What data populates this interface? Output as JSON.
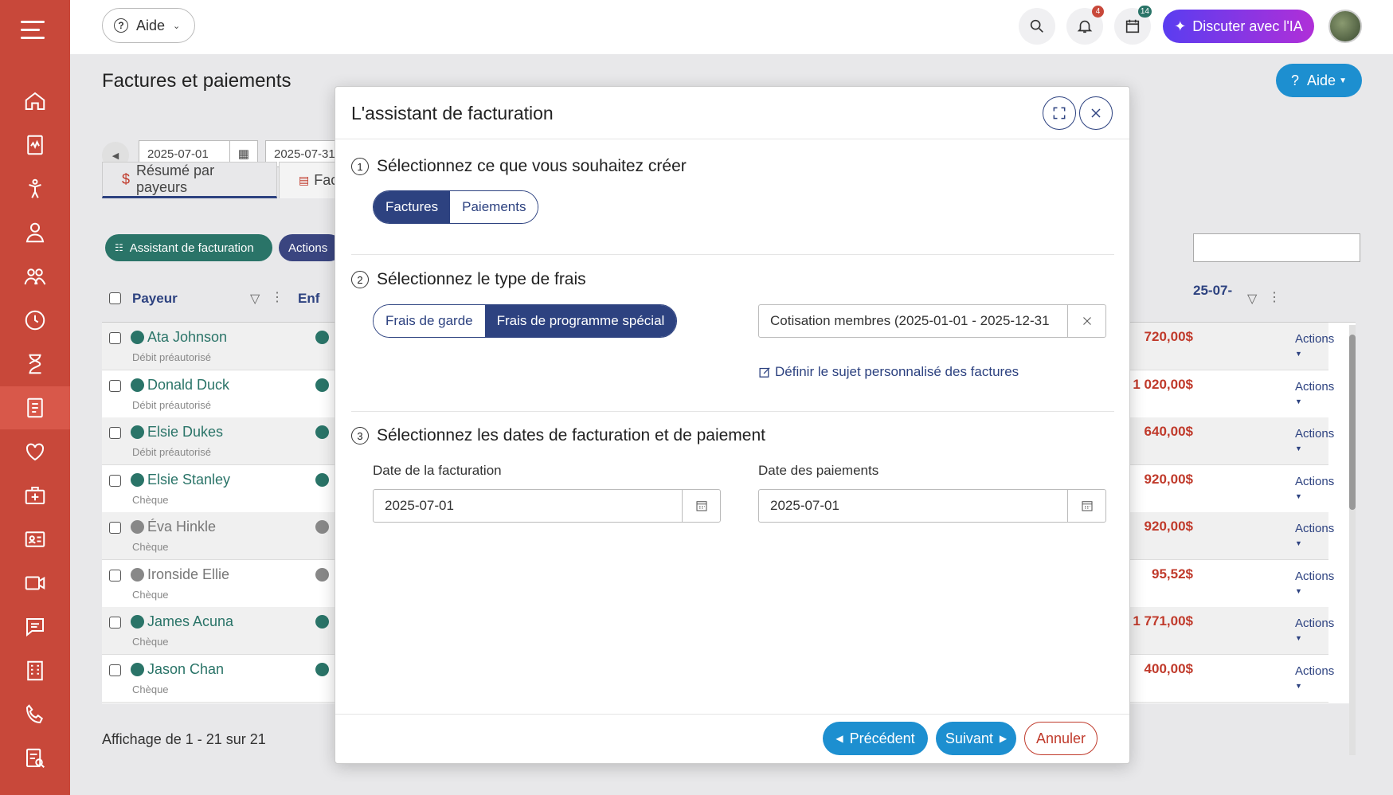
{
  "topbar": {
    "help_label": "Aide",
    "ai_label": "Discuter avec l'IA",
    "notif_count": "4",
    "calendar_count": "14"
  },
  "page": {
    "title": "Factures et paiements",
    "help_label": "Aide",
    "date_from": "2025-07-01",
    "date_to": "2025-07-31",
    "tabs": [
      "Résumé par payeurs",
      "Fac"
    ],
    "billing_assistant_label": "Assistant de facturation",
    "actions_label": "Actions",
    "col_payer": "Payeur",
    "col_child": "Enf",
    "col_date_fragment": "25-07-",
    "footer": "Affichage de 1 - 21 sur 21"
  },
  "rows": [
    {
      "name": "Ata Johnson",
      "method": "Débit préautorisé",
      "amount": "720,00$",
      "action": "Actions",
      "status": "active"
    },
    {
      "name": "Donald Duck",
      "method": "Débit préautorisé",
      "amount": "1 020,00$",
      "action": "Actions",
      "status": "active"
    },
    {
      "name": "Elsie Dukes",
      "method": "Débit préautorisé",
      "amount": "640,00$",
      "action": "Actions",
      "status": "active"
    },
    {
      "name": "Elsie Stanley",
      "method": "Chèque",
      "amount": "920,00$",
      "action": "Actions",
      "status": "active"
    },
    {
      "name": "Éva Hinkle",
      "method": "Chèque",
      "amount": "920,00$",
      "action": "Actions",
      "status": "inactive"
    },
    {
      "name": "Ironside Ellie",
      "method": "Chèque",
      "amount": "95,52$",
      "action": "Actions",
      "status": "inactive"
    },
    {
      "name": "James Acuna",
      "method": "Chèque",
      "amount": "1 771,00$",
      "action": "Actions",
      "status": "active"
    },
    {
      "name": "Jason Chan",
      "method": "Chèque",
      "amount": "400,00$",
      "action": "Actions",
      "status": "active"
    }
  ],
  "modal": {
    "title": "L'assistant de facturation",
    "step1": {
      "num": "1",
      "label": "Sélectionnez ce que vous souhaitez créer",
      "options": [
        "Factures",
        "Paiements"
      ],
      "selected": "Factures"
    },
    "step2": {
      "num": "2",
      "label": "Sélectionnez le type de frais",
      "options": [
        "Frais de garde",
        "Frais de programme spécial"
      ],
      "selected": "Frais de programme spécial",
      "program_value": "Cotisation membres (2025-01-01 - 2025-12-31",
      "custom_subject_link": "Définir le sujet personnalisé des factures"
    },
    "step3": {
      "num": "3",
      "label": "Sélectionnez les dates de facturation et de paiement",
      "invoice_date_label": "Date de la facturation",
      "invoice_date": "2025-07-01",
      "payment_date_label": "Date des paiements",
      "payment_date": "2025-07-01"
    },
    "prev_label": "Précédent",
    "next_label": "Suivant",
    "cancel_label": "Annuler"
  },
  "colors": {
    "sidebar": "#c8483a",
    "primary": "#2d4280",
    "accent_blue": "#1d8fd0",
    "green": "#2a7468",
    "amount_red": "#c03a2b"
  }
}
